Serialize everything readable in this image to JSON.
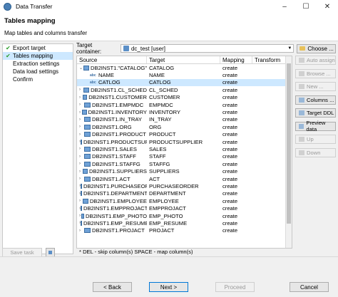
{
  "window": {
    "title": "Data Transfer",
    "minimize": "–",
    "maximize": "☐",
    "close": "✕"
  },
  "header": {
    "title": "Tables mapping",
    "subtitle": "Map tables and columns transfer"
  },
  "nav": {
    "items": [
      {
        "label": "Export target",
        "done": true
      },
      {
        "label": "Tables mapping",
        "done": true,
        "selected": true
      },
      {
        "label": "Extraction settings",
        "done": false
      },
      {
        "label": "Data load settings",
        "done": false
      },
      {
        "label": "Confirm",
        "done": false
      }
    ]
  },
  "target": {
    "label": "Target container:",
    "value": "dc_test  [user]",
    "choose_label": "Choose ..."
  },
  "grid": {
    "columns": [
      "Source",
      "Target",
      "Mapping",
      "Transform"
    ],
    "rows": [
      {
        "source": "DB2INST1.\"CATALOG\"",
        "target": "CATALOG",
        "mapping": "create",
        "kind": "table",
        "expanded": true
      },
      {
        "source": "NAME",
        "target": "NAME",
        "mapping": "create",
        "kind": "column"
      },
      {
        "source": "CATLOG",
        "target": "CATLOG",
        "mapping": "create",
        "kind": "column",
        "selected": true
      },
      {
        "source": "DB2INST1.CL_SCHED",
        "target": "CL_SCHED",
        "mapping": "create",
        "kind": "table"
      },
      {
        "source": "DB2INST1.CUSTOMER",
        "target": "CUSTOMER",
        "mapping": "create",
        "kind": "table"
      },
      {
        "source": "DB2INST1.EMPMDC",
        "target": "EMPMDC",
        "mapping": "create",
        "kind": "table"
      },
      {
        "source": "DB2INST1.INVENTORY",
        "target": "INVENTORY",
        "mapping": "create",
        "kind": "table"
      },
      {
        "source": "DB2INST1.IN_TRAY",
        "target": "IN_TRAY",
        "mapping": "create",
        "kind": "table"
      },
      {
        "source": "DB2INST1.ORG",
        "target": "ORG",
        "mapping": "create",
        "kind": "table"
      },
      {
        "source": "DB2INST1.PRODUCT",
        "target": "PRODUCT",
        "mapping": "create",
        "kind": "table"
      },
      {
        "source": "DB2INST1.PRODUCTSUPPI",
        "target": "PRODUCTSUPPLIER",
        "mapping": "create",
        "kind": "table"
      },
      {
        "source": "DB2INST1.SALES",
        "target": "SALES",
        "mapping": "create",
        "kind": "table"
      },
      {
        "source": "DB2INST1.STAFF",
        "target": "STAFF",
        "mapping": "create",
        "kind": "table"
      },
      {
        "source": "DB2INST1.STAFFG",
        "target": "STAFFG",
        "mapping": "create",
        "kind": "table"
      },
      {
        "source": "DB2INST1.SUPPLIERS",
        "target": "SUPPLIERS",
        "mapping": "create",
        "kind": "table"
      },
      {
        "source": "DB2INST1.ACT",
        "target": "ACT",
        "mapping": "create",
        "kind": "table"
      },
      {
        "source": "DB2INST1.PURCHASEORI",
        "target": "PURCHASEORDER",
        "mapping": "create",
        "kind": "table"
      },
      {
        "source": "DB2INST1.DEPARTMENT",
        "target": "DEPARTMENT",
        "mapping": "create",
        "kind": "table"
      },
      {
        "source": "DB2INST1.EMPLOYEE",
        "target": "EMPLOYEE",
        "mapping": "create",
        "kind": "table"
      },
      {
        "source": "DB2INST1.EMPPROJACT",
        "target": "EMPPROJACT",
        "mapping": "create",
        "kind": "table"
      },
      {
        "source": "DB2INST1.EMP_PHOTO",
        "target": "EMP_PHOTO",
        "mapping": "create",
        "kind": "table"
      },
      {
        "source": "DB2INST1.EMP_RESUME",
        "target": "EMP_RESUME",
        "mapping": "create",
        "kind": "table"
      },
      {
        "source": "DB2INST1.PROJACT",
        "target": "PROJACT",
        "mapping": "create",
        "kind": "table"
      }
    ]
  },
  "side_buttons": [
    {
      "label": "Auto assign",
      "enabled": false,
      "icon": "auto-assign-icon"
    },
    {
      "label": "Browse ...",
      "enabled": false,
      "icon": "browse-icon"
    },
    {
      "label": "New ...",
      "enabled": false,
      "icon": "new-icon"
    },
    {
      "label": "Columns ...",
      "enabled": true,
      "icon": "columns-icon"
    },
    {
      "label": "Target DDL",
      "enabled": true,
      "icon": "ddl-icon"
    },
    {
      "label": "Preview data",
      "enabled": true,
      "icon": "preview-icon"
    },
    {
      "label": "Up",
      "enabled": false,
      "icon": "up-arrow-icon"
    },
    {
      "label": "Down",
      "enabled": false,
      "icon": "down-arrow-icon"
    }
  ],
  "hint": "* DEL - skip column(s)  SPACE - map column(s)",
  "save_task": "Save task",
  "footer": {
    "back": "< Back",
    "next": "Next >",
    "proceed": "Proceed",
    "cancel": "Cancel"
  }
}
